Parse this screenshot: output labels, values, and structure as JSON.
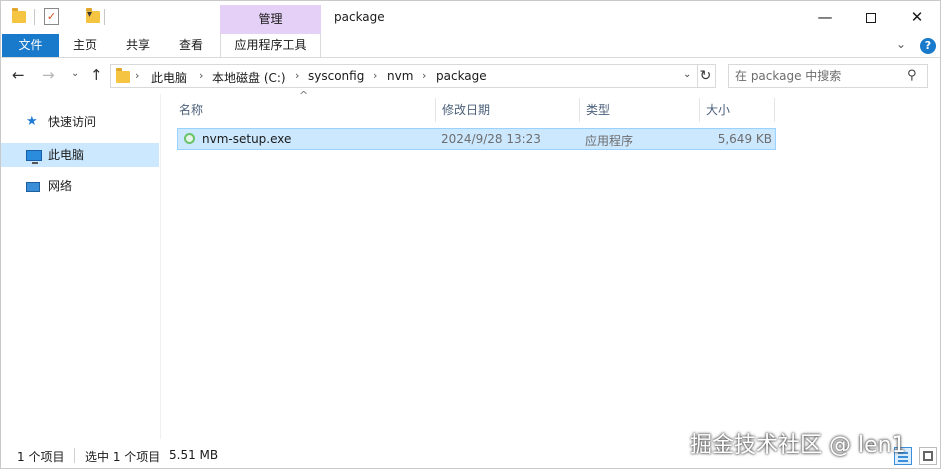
{
  "titlebar": {
    "manage_tab": "管理",
    "window_title": "package",
    "minimize": "—",
    "close": "✕"
  },
  "ribbon": {
    "tabs": [
      "文件",
      "主页",
      "共享",
      "查看",
      "应用程序工具"
    ],
    "expand_glyph": "⌄",
    "help_glyph": "?"
  },
  "address": {
    "crumbs": [
      "此电脑",
      "本地磁盘 (C:)",
      "sysconfig",
      "nvm",
      "package"
    ],
    "separator": "›",
    "search_placeholder": "在 package 中搜索"
  },
  "navpane": {
    "items": [
      {
        "label": "快速访问",
        "icon": "star-icon"
      },
      {
        "label": "此电脑",
        "icon": "computer-icon"
      },
      {
        "label": "网络",
        "icon": "network-icon"
      }
    ]
  },
  "columns": {
    "name": "名称",
    "date": "修改日期",
    "type": "类型",
    "size": "大小"
  },
  "files": [
    {
      "name": "nvm-setup.exe",
      "date": "2024/9/28 13:23",
      "type": "应用程序",
      "size": "5,649 KB"
    }
  ],
  "status": {
    "item_count": "1 个项目",
    "selected": "选中 1 个项目",
    "selected_size": "5.51 MB"
  },
  "watermark": "掘金技术社区 @ len1",
  "colors": {
    "file_tab": "#1979ca",
    "manage_tab": "#e5d0f7",
    "selection": "#cce8ff",
    "selection_border": "#99d1ff"
  }
}
